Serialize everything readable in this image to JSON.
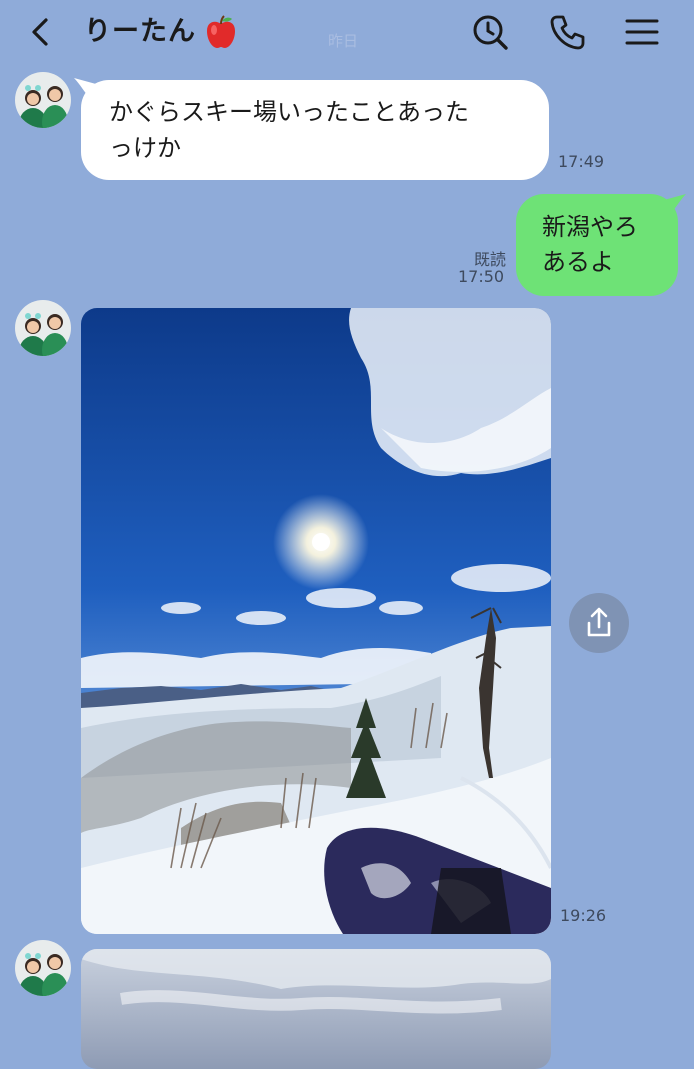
{
  "header": {
    "title": "りーたん",
    "title_emoji": "apple-icon",
    "faint_date": "昨日",
    "icons": [
      "back-chevron-icon",
      "search-clock-icon",
      "phone-icon",
      "menu-icon"
    ]
  },
  "messages": [
    {
      "side": "in",
      "lines": [
        "かぐらスキー場いったことあった",
        "っけか"
      ],
      "time": "17:49"
    },
    {
      "side": "out",
      "lines": [
        "新潟やろ",
        "あるよ"
      ],
      "read": "既読",
      "time": "17:50"
    },
    {
      "side": "in",
      "type": "photo",
      "time": "19:26"
    },
    {
      "side": "in",
      "type": "photo"
    }
  ],
  "colors": {
    "background": "#8fabd9",
    "incoming_bubble": "#ffffff",
    "outgoing_bubble": "#6ee276"
  },
  "share_icon": "share-icon"
}
